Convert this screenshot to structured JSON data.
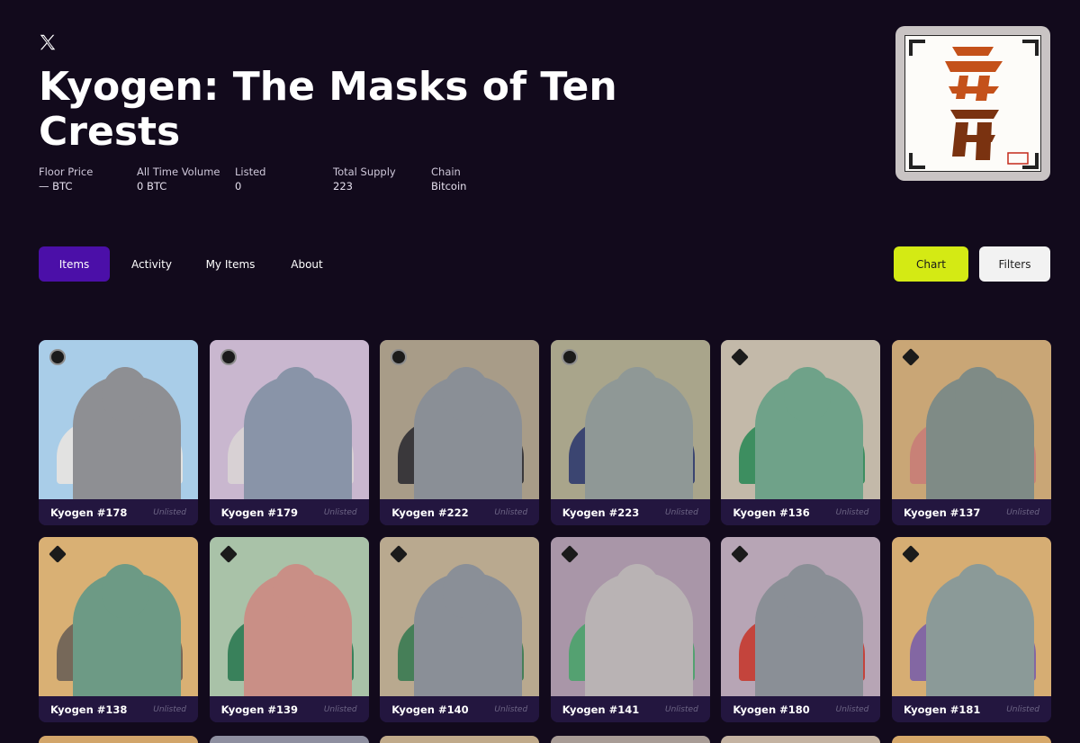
{
  "header": {
    "social_icon": "x-logo-icon",
    "title": "Kyogen: The Masks of Ten Crests"
  },
  "stats": [
    {
      "label": "Floor Price",
      "value": "— BTC"
    },
    {
      "label": "All Time Volume",
      "value": "0 BTC"
    },
    {
      "label": "Listed",
      "value": "0"
    },
    {
      "label": "Total Supply",
      "value": "223"
    },
    {
      "label": "Chain",
      "value": "Bitcoin"
    }
  ],
  "tabs": [
    {
      "label": "Items",
      "active": true
    },
    {
      "label": "Activity",
      "active": false
    },
    {
      "label": "My Items",
      "active": false
    },
    {
      "label": "About",
      "active": false
    }
  ],
  "actions": {
    "chart_label": "Chart",
    "filters_label": "Filters"
  },
  "colors": {
    "background": "#120a1c",
    "tab_active": "#4b0fa8",
    "chart_button": "#d4ea14",
    "filters_button": "#f2f2f2",
    "card_footer": "#23163f"
  },
  "items": [
    {
      "name": "Kyogen #178",
      "status": "Unlisted",
      "bg": "#a9cde8",
      "skin": "#8e8f93",
      "accent": "#e8e4e0",
      "crest": "circle"
    },
    {
      "name": "Kyogen #179",
      "status": "Unlisted",
      "bg": "#c9b7cf",
      "skin": "#8994a8",
      "accent": "#d9d4d4",
      "crest": "circle"
    },
    {
      "name": "Kyogen #222",
      "status": "Unlisted",
      "bg": "#a89c88",
      "skin": "#8a8f96",
      "accent": "#2d2d33",
      "crest": "circle"
    },
    {
      "name": "Kyogen #223",
      "status": "Unlisted",
      "bg": "#a9a58b",
      "skin": "#8f9896",
      "accent": "#2f3b6e",
      "crest": "circle"
    },
    {
      "name": "Kyogen #136",
      "status": "Unlisted",
      "bg": "#c3b9a9",
      "skin": "#6fa289",
      "accent": "#2f8a58",
      "crest": "diamond"
    },
    {
      "name": "Kyogen #137",
      "status": "Unlisted",
      "bg": "#c9a676",
      "skin": "#7f8b86",
      "accent": "#c87d78",
      "crest": "diamond"
    },
    {
      "name": "Kyogen #138",
      "status": "Unlisted",
      "bg": "#d9b074",
      "skin": "#6d9a85",
      "accent": "#6a6157",
      "crest": "diamond"
    },
    {
      "name": "Kyogen #139",
      "status": "Unlisted",
      "bg": "#a9c2a8",
      "skin": "#c98f86",
      "accent": "#2c7a52",
      "crest": "diamond"
    },
    {
      "name": "Kyogen #140",
      "status": "Unlisted",
      "bg": "#b9a98f",
      "skin": "#8a8f97",
      "accent": "#3a7a52",
      "crest": "diamond"
    },
    {
      "name": "Kyogen #141",
      "status": "Unlisted",
      "bg": "#a996a8",
      "skin": "#b9b3b4",
      "accent": "#4aa26a",
      "crest": "diamond"
    },
    {
      "name": "Kyogen #180",
      "status": "Unlisted",
      "bg": "#b7a5b5",
      "skin": "#8a8f96",
      "accent": "#c53a2f",
      "crest": "diamond"
    },
    {
      "name": "Kyogen #181",
      "status": "Unlisted",
      "bg": "#d6ad73",
      "skin": "#8b9a98",
      "accent": "#7a5fa8",
      "crest": "diamond"
    }
  ],
  "next_row_bgs": [
    "#d2a56a",
    "#8e8fa0",
    "#c0aa8a",
    "#a89c96",
    "#c4b3a2",
    "#d6a86a"
  ]
}
